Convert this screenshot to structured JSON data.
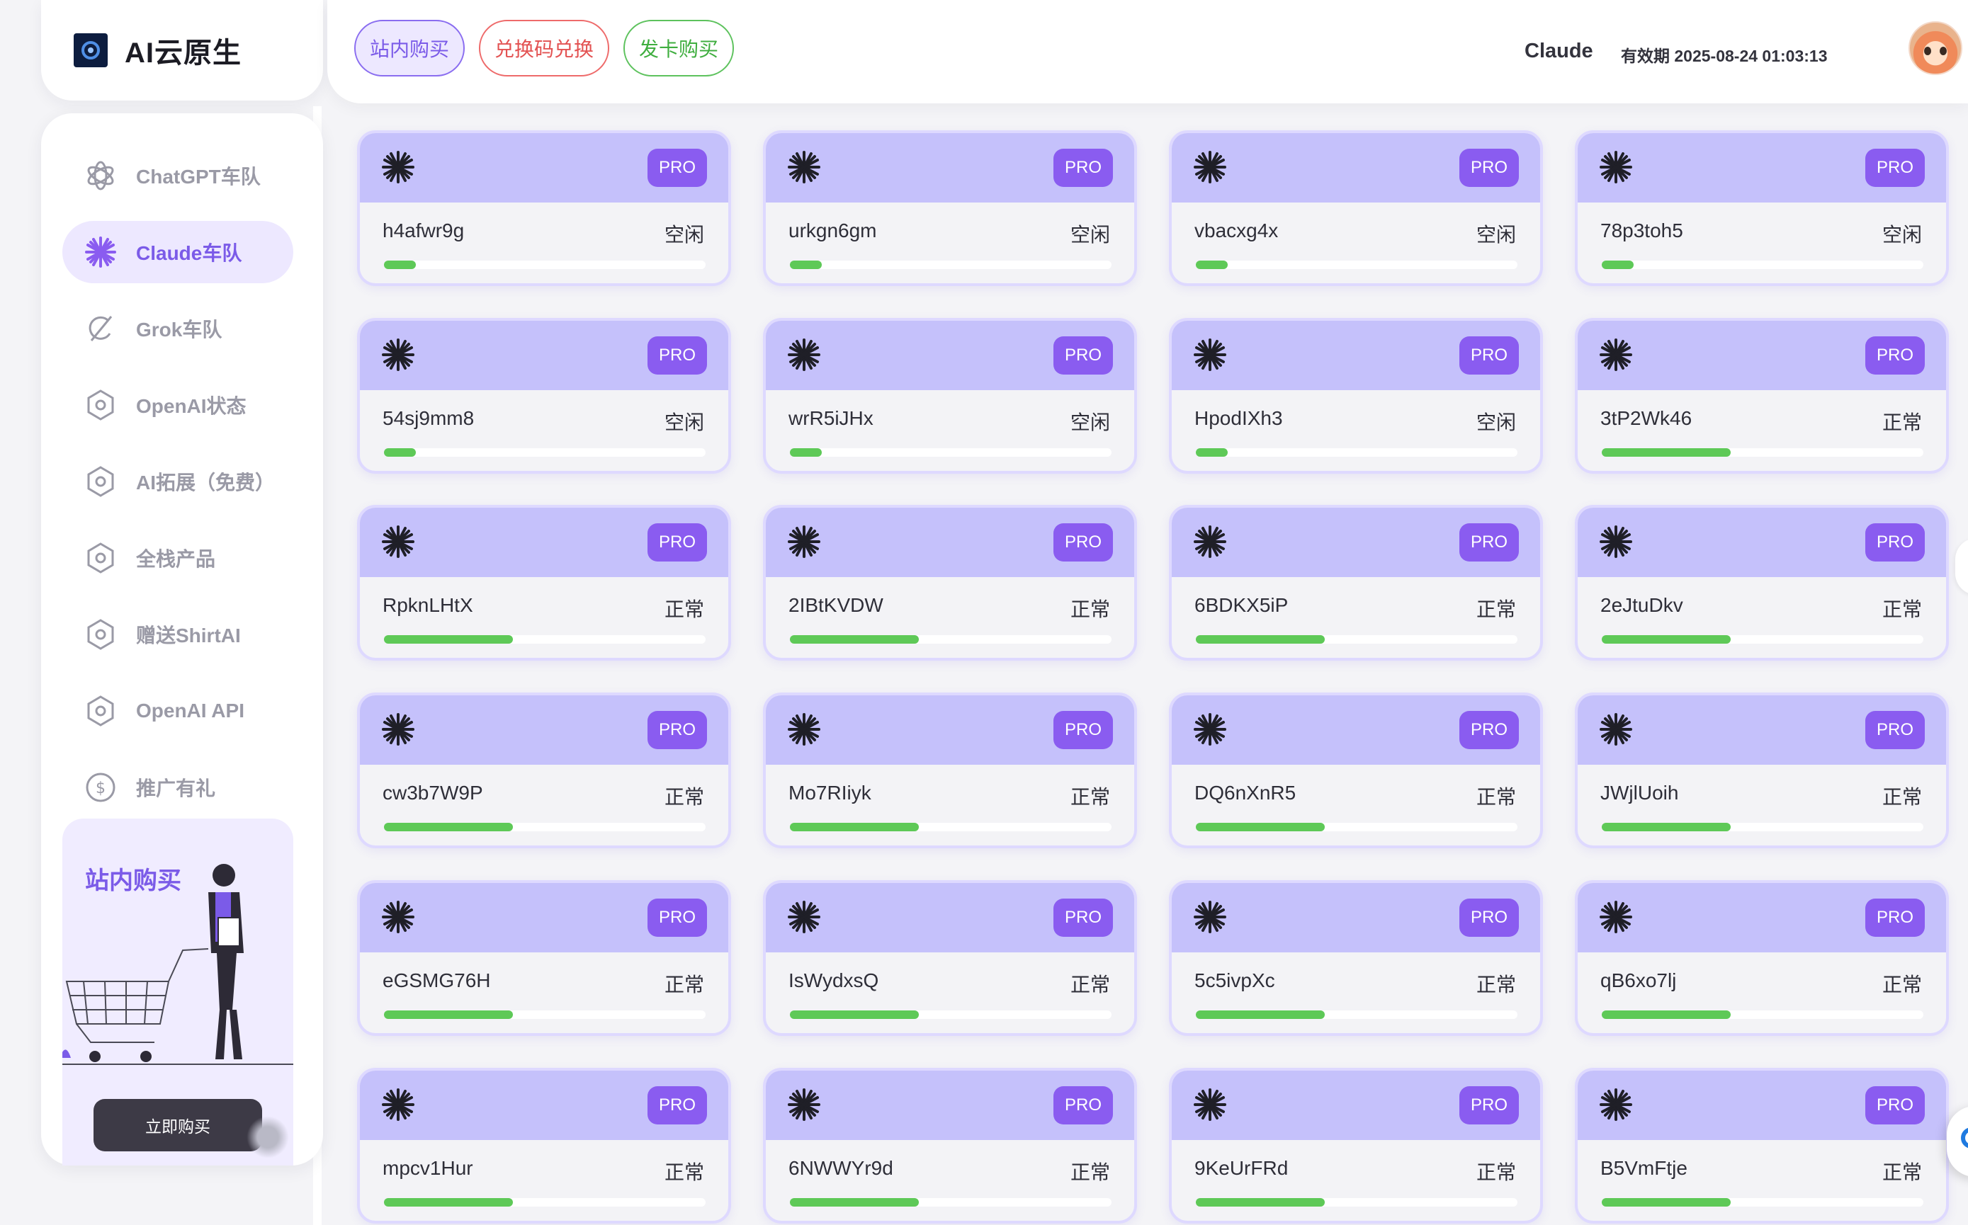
{
  "app": {
    "logo_text": "AI云原生",
    "logo_icon": "openai-logo-icon"
  },
  "header": {
    "buttons": [
      {
        "label": "站内购买",
        "color": "#7b5be8"
      },
      {
        "label": "兑换码兑换",
        "color": "#e35252"
      },
      {
        "label": "发卡购买",
        "color": "#3fae3f"
      }
    ],
    "username": "Claude",
    "expiry": "有效期 2025-08-24 01:03:13",
    "avatar_icon": "avatar-icon"
  },
  "sidebar": {
    "items": [
      {
        "label": "ChatGPT车队",
        "icon": "chatgpt-icon",
        "active": false
      },
      {
        "label": "Claude车队",
        "icon": "claude-icon",
        "active": true
      },
      {
        "label": "Grok车队",
        "icon": "grok-icon",
        "active": false
      },
      {
        "label": "OpenAI状态",
        "icon": "hexagon-icon",
        "active": false
      },
      {
        "label": "AI拓展（免费）",
        "icon": "hexagon-icon",
        "active": false
      },
      {
        "label": "全栈产品",
        "icon": "hexagon-icon",
        "active": false
      },
      {
        "label": "赠送ShirtAI",
        "icon": "hexagon-icon",
        "active": false
      },
      {
        "label": "OpenAI API",
        "icon": "hexagon-icon",
        "active": false
      },
      {
        "label": "推广有礼",
        "icon": "dollar-icon",
        "active": false
      }
    ],
    "promo": {
      "title": "站内购买",
      "button": "立即购买"
    }
  },
  "colors": {
    "accent": "#7b5be8",
    "card_header": "#c5c1fb",
    "badge": "#8a5cf0",
    "progress": "#5ec957"
  },
  "cards": [
    {
      "name": "h4afwr9g",
      "status": "空闲",
      "badge": "PRO",
      "progress": 0.1
    },
    {
      "name": "urkgn6gm",
      "status": "空闲",
      "badge": "PRO",
      "progress": 0.1
    },
    {
      "name": "vbacxg4x",
      "status": "空闲",
      "badge": "PRO",
      "progress": 0.1
    },
    {
      "name": "78p3toh5",
      "status": "空闲",
      "badge": "PRO",
      "progress": 0.1
    },
    {
      "name": "54sj9mm8",
      "status": "空闲",
      "badge": "PRO",
      "progress": 0.1
    },
    {
      "name": "wrR5iJHx",
      "status": "空闲",
      "badge": "PRO",
      "progress": 0.1
    },
    {
      "name": "HpodIXh3",
      "status": "空闲",
      "badge": "PRO",
      "progress": 0.1
    },
    {
      "name": "3tP2Wk46",
      "status": "正常",
      "badge": "PRO",
      "progress": 0.4
    },
    {
      "name": "RpknLHtX",
      "status": "正常",
      "badge": "PRO",
      "progress": 0.4
    },
    {
      "name": "2IBtKVDW",
      "status": "正常",
      "badge": "PRO",
      "progress": 0.4
    },
    {
      "name": "6BDKX5iP",
      "status": "正常",
      "badge": "PRO",
      "progress": 0.4
    },
    {
      "name": "2eJtuDkv",
      "status": "正常",
      "badge": "PRO",
      "progress": 0.4
    },
    {
      "name": "cw3b7W9P",
      "status": "正常",
      "badge": "PRO",
      "progress": 0.4
    },
    {
      "name": "Mo7RIiyk",
      "status": "正常",
      "badge": "PRO",
      "progress": 0.4
    },
    {
      "name": "DQ6nXnR5",
      "status": "正常",
      "badge": "PRO",
      "progress": 0.4
    },
    {
      "name": "JWjlUoih",
      "status": "正常",
      "badge": "PRO",
      "progress": 0.4
    },
    {
      "name": "eGSMG76H",
      "status": "正常",
      "badge": "PRO",
      "progress": 0.4
    },
    {
      "name": "IsWydxsQ",
      "status": "正常",
      "badge": "PRO",
      "progress": 0.4
    },
    {
      "name": "5c5ivpXc",
      "status": "正常",
      "badge": "PRO",
      "progress": 0.4
    },
    {
      "name": "qB6xo7lj",
      "status": "正常",
      "badge": "PRO",
      "progress": 0.4
    },
    {
      "name": "mpcv1Hur",
      "status": "正常",
      "badge": "PRO",
      "progress": 0.4
    },
    {
      "name": "6NWWYr9d",
      "status": "正常",
      "badge": "PRO",
      "progress": 0.4
    },
    {
      "name": "9KeUrFRd",
      "status": "正常",
      "badge": "PRO",
      "progress": 0.4
    },
    {
      "name": "B5VmFtje",
      "status": "正常",
      "badge": "PRO",
      "progress": 0.4
    }
  ]
}
